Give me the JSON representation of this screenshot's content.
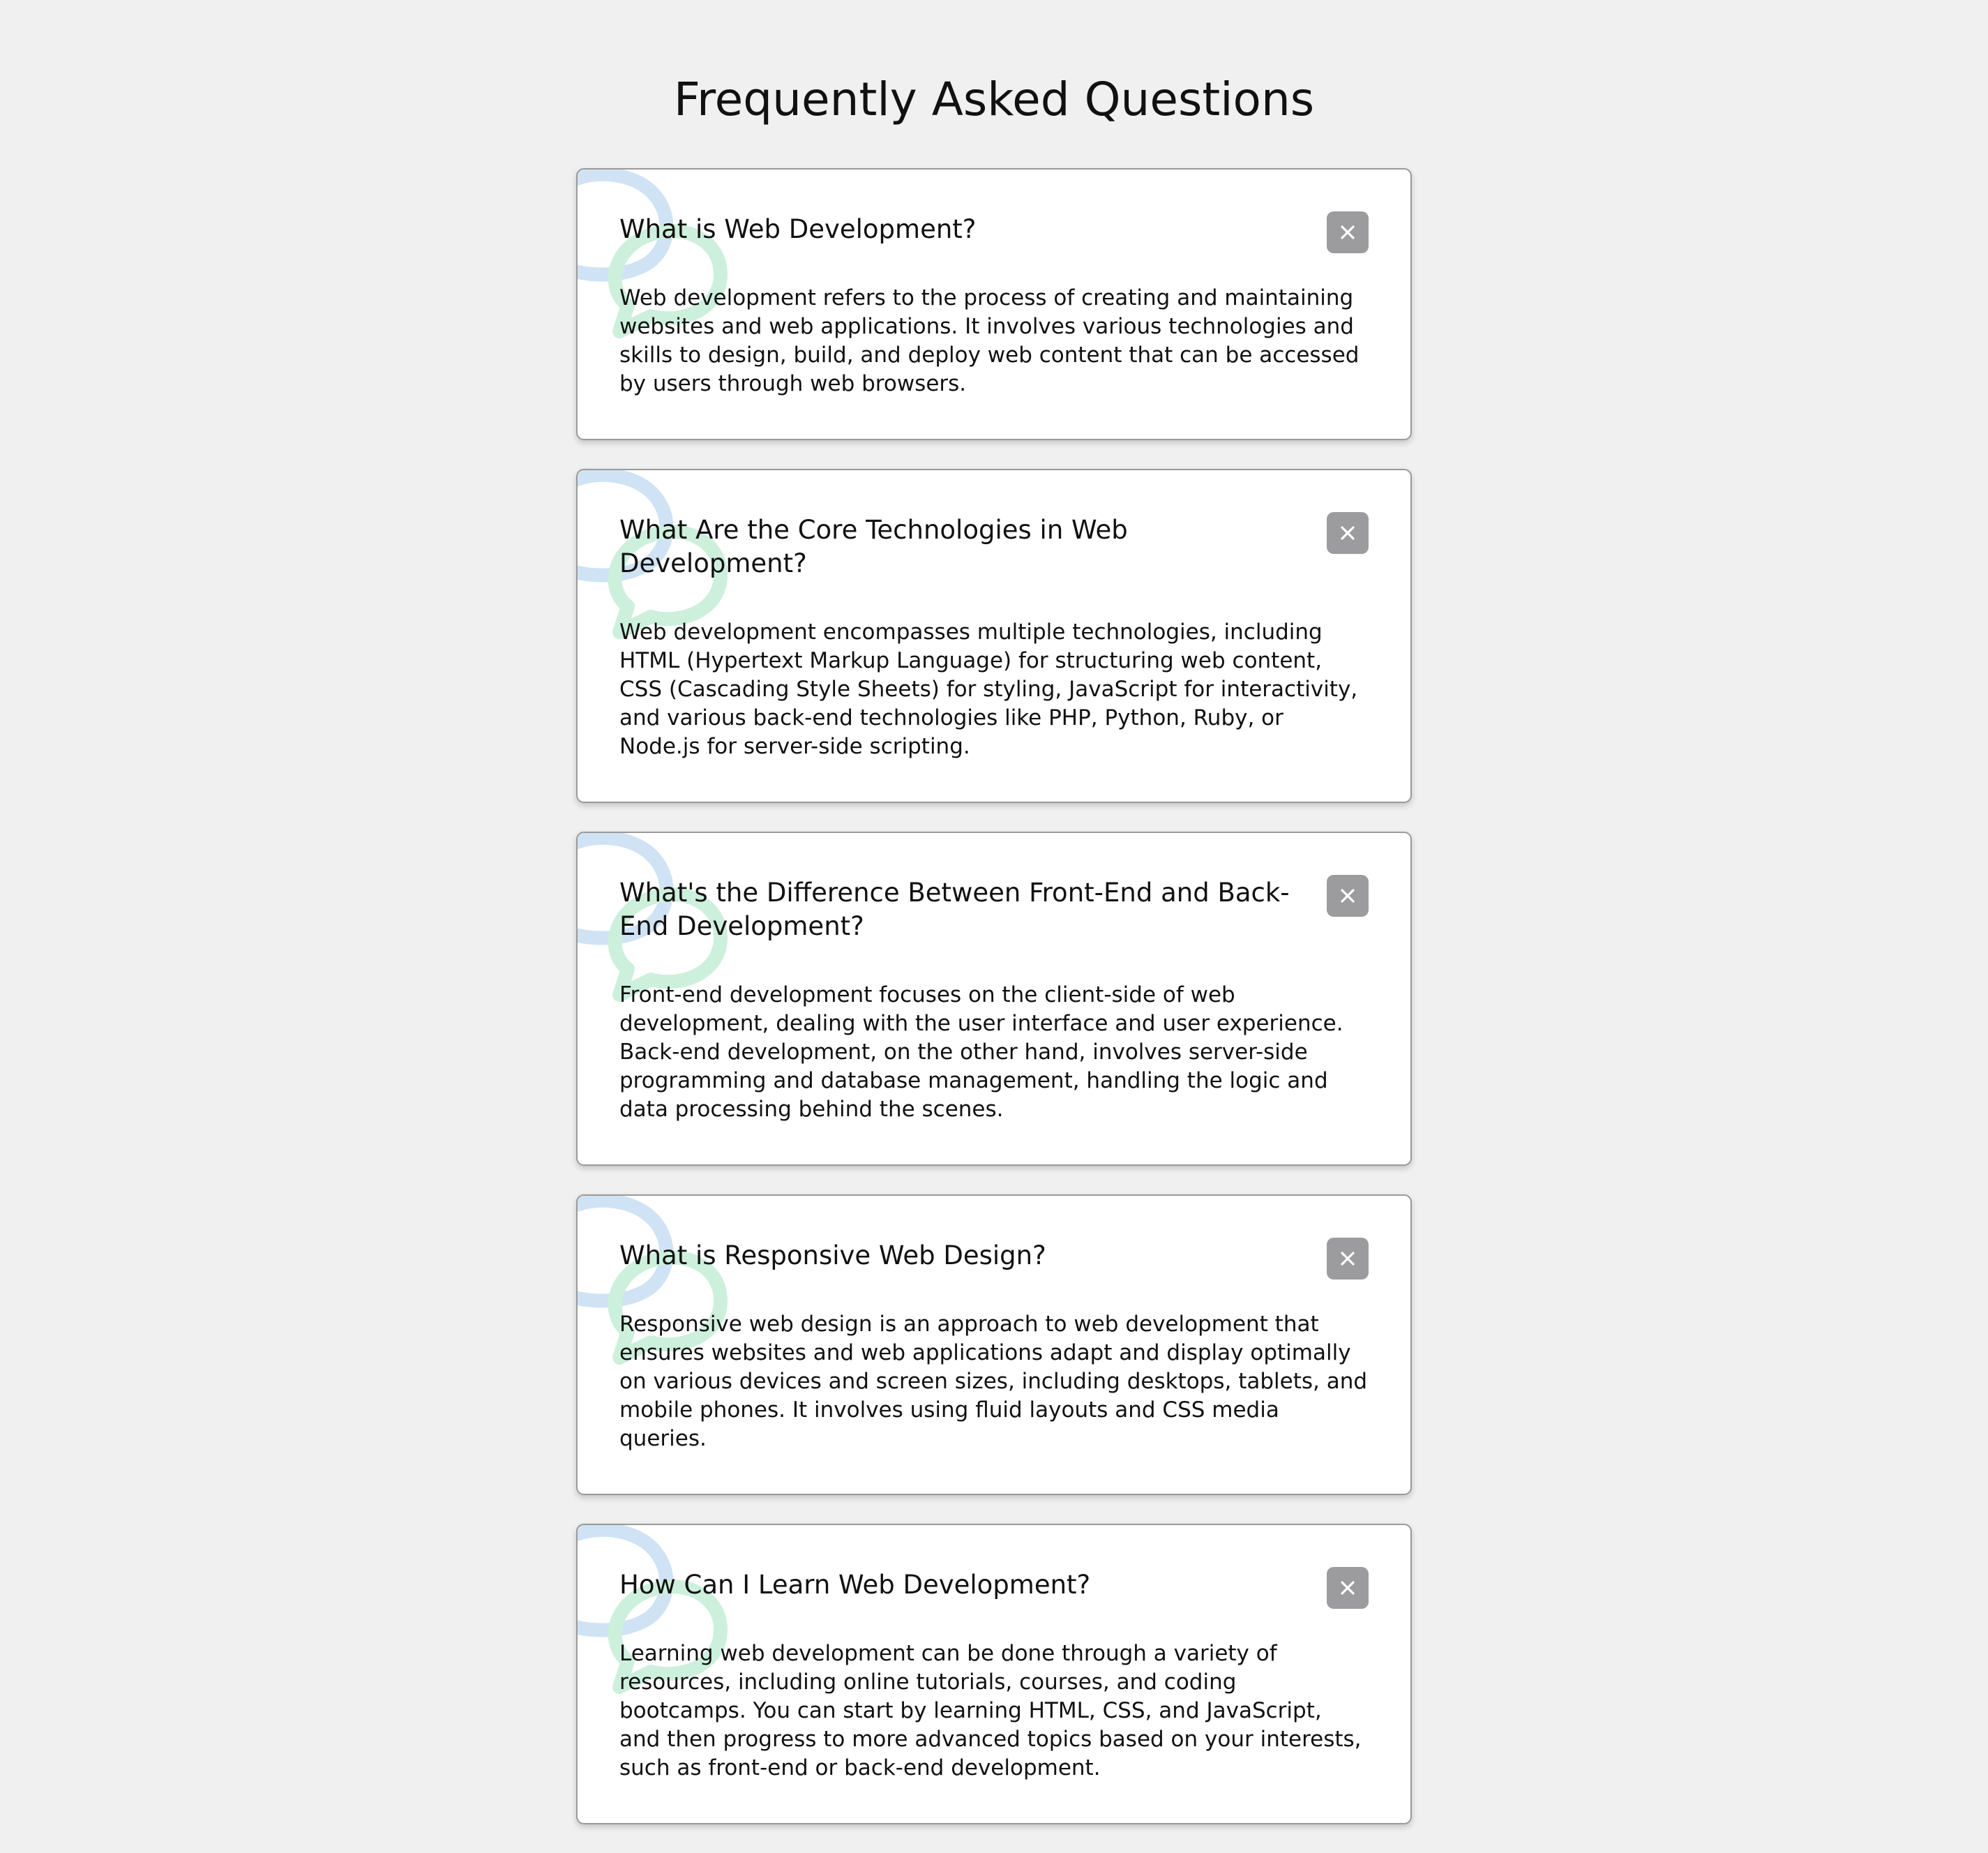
{
  "page": {
    "title": "Frequently Asked Questions"
  },
  "colors": {
    "background": "#f0f0f0",
    "card": "#ffffff",
    "button": "#9c9c9e",
    "bubble_blue": "#cfe3f5",
    "bubble_green": "#cdf0dc"
  },
  "icons": {
    "toggle": "close-icon",
    "decoration": "chat-bubbles-icon"
  },
  "faq": [
    {
      "question": "What is Web Development?",
      "answer": "Web development refers to the process of creating and maintaining websites and web applications. It involves various technologies and skills to design, build, and deploy web content that can be accessed by users through web browsers."
    },
    {
      "question": "What Are the Core Technologies in Web Development?",
      "answer": "Web development encompasses multiple technologies, including HTML (Hypertext Markup Language) for structuring web content, CSS (Cascading Style Sheets) for styling, JavaScript for interactivity, and various back-end technologies like PHP, Python, Ruby, or Node.js for server-side scripting."
    },
    {
      "question": "What's the Difference Between Front-End and Back-End Development?",
      "answer": "Front-end development focuses on the client-side of web development, dealing with the user interface and user experience. Back-end development, on the other hand, involves server-side programming and database management, handling the logic and data processing behind the scenes."
    },
    {
      "question": "What is Responsive Web Design?",
      "answer": "Responsive web design is an approach to web development that ensures websites and web applications adapt and display optimally on various devices and screen sizes, including desktops, tablets, and mobile phones. It involves using fluid layouts and CSS media queries."
    },
    {
      "question": "How Can I Learn Web Development?",
      "answer": "Learning web development can be done through a variety of resources, including online tutorials, courses, and coding bootcamps. You can start by learning HTML, CSS, and JavaScript, and then progress to more advanced topics based on your interests, such as front-end or back-end development."
    }
  ]
}
